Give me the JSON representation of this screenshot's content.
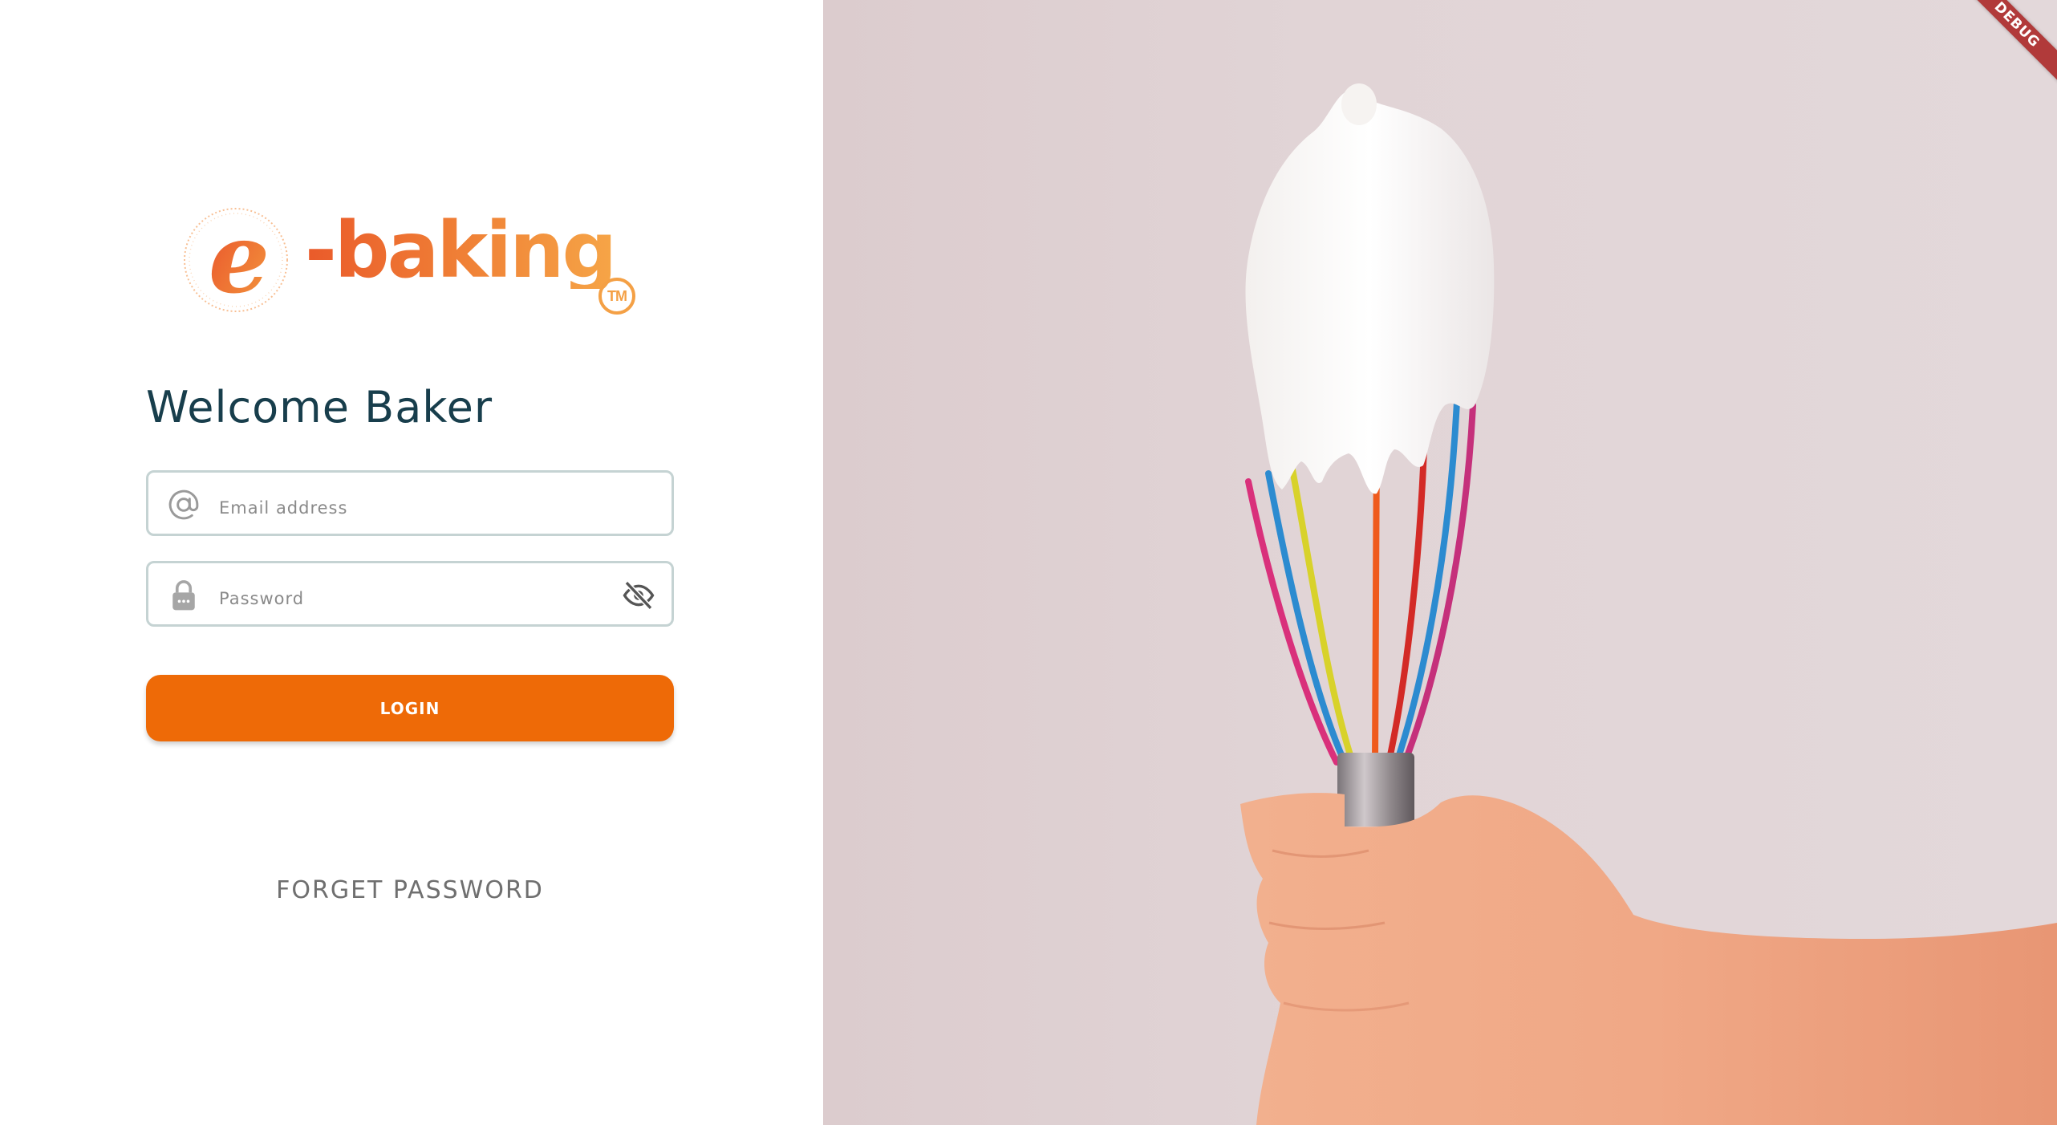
{
  "brand": {
    "logo_letter": "e",
    "logo_text": "-baking",
    "trademark": "TM"
  },
  "login": {
    "heading": "Welcome Baker",
    "email": {
      "placeholder": "Email address",
      "value": "",
      "icon": "at-sign-icon"
    },
    "password": {
      "placeholder": "Password",
      "value": "",
      "icon": "lock-icon",
      "toggle_icon": "eye-off-icon"
    },
    "login_label": "LOGIN",
    "forget_label": "FORGET PASSWORD"
  },
  "hero_image": {
    "subject": "hand-holding-whisk-with-whipped-cream"
  },
  "debug_banner": "DEBUG",
  "colors": {
    "accent": "#ee6a07",
    "heading": "#183e4c",
    "field_border": "#c5d3d3",
    "hero_background": "#e1d4d6"
  }
}
